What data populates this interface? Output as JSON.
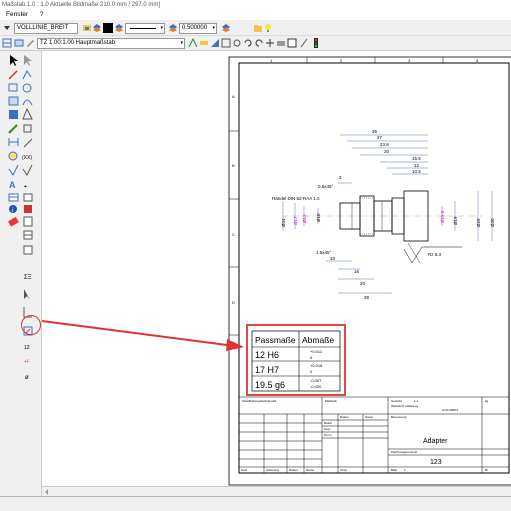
{
  "window": {
    "title": "Maßstab 1.0 : 1.0   Aktuelle Bildmaße 210.0 mm / 297.0 mm]",
    "menu": [
      "Fenster",
      "?"
    ]
  },
  "toolbar1": {
    "layer_combo": "VOLLLINIE_BREIT",
    "line_width": "0.500000"
  },
  "toolbar2": {
    "scale_combo": "TZ 1.00:1.00 Hauptmaßstab"
  },
  "drawing": {
    "column_labels": [
      "1",
      "2",
      "3",
      "4"
    ],
    "row_labels": [
      "A",
      "B",
      "C",
      "D"
    ],
    "dimensions": {
      "d36": "36",
      "d27": "27",
      "d23": "23.8",
      "d20": "20",
      "d155": "15.5",
      "d12": "12",
      "d105": "10.5",
      "d3": "3",
      "chamfer1": "0.8x45°",
      "chamfer2": "1.5x45°",
      "d10": "10",
      "d16": "16",
      "d20b": "20",
      "d38": "38",
      "dia_left": "Ø34",
      "dia17": "Ø17",
      "dia12": "Ø12",
      "dia10": "Ø10",
      "dia19": "Ø19",
      "dia29": "Ø29",
      "dia30": "Ø30",
      "dia195": "Ø19.5",
      "roughness": "Rz 6.3",
      "thread_note": "Rändel DIN 82-RAA 1.0"
    },
    "fit_table": {
      "headers": [
        "Passmaße",
        "Abmaße"
      ],
      "rows": [
        {
          "fit": "12 H6",
          "upper": "+0.011",
          "lower": "0"
        },
        {
          "fit": "17 H7",
          "upper": "+0.018",
          "lower": "0"
        },
        {
          "fit": "19.5 g6",
          "upper": "-0.007",
          "lower": "-0.020"
        }
      ]
    },
    "titleblock": {
      "part_name": "Adapter",
      "drawing_number": "123",
      "material_label": "Werkstoff, Halbzeug",
      "material_value": "CuZn39Pb3",
      "scale_label": "Maßstab",
      "scale_value": "1:1",
      "mass_label": "Gewicht",
      "mass_value": "kg",
      "general_tol": "Oberflächengüte/Freimaß",
      "date_label": "Datum",
      "name_label": "Name",
      "bearb": "Bearb",
      "gepr": "Gepr",
      "norm": "Norm",
      "designation_label": "Benennung",
      "drawing_number_label": "Zeichnungsnummer",
      "state_label": "Zust",
      "change_label": "Änderung",
      "date2": "Datum",
      "name2": "Name",
      "origin_label": "Urspr",
      "sheet_label": "Blatt",
      "sheet_value": "1",
      "sheets_total": "Bl"
    }
  }
}
